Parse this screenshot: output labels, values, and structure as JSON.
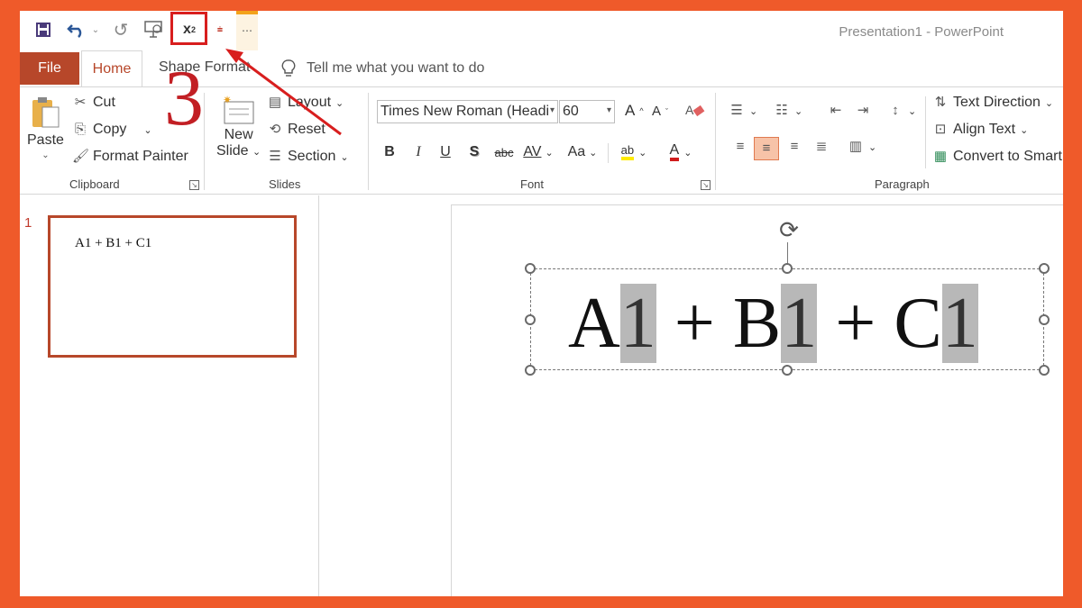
{
  "app": {
    "title": "Presentation1  -  PowerPoint"
  },
  "qat": {
    "save_icon": "save-icon",
    "undo_icon": "undo-icon",
    "redo_icon": "redo-icon",
    "present_icon": "present-from-start-icon",
    "subscript_label": "x",
    "subscript_sub": "2",
    "more_label": "⋯"
  },
  "tabs": {
    "file": "File",
    "home": "Home",
    "shape_format": "Shape Format",
    "tell_me": "Tell me what you want to do"
  },
  "ribbon": {
    "clipboard": {
      "paste": "Paste",
      "cut": "Cut",
      "copy": "Copy",
      "format_painter": "Format Painter",
      "label": "Clipboard"
    },
    "slides": {
      "new_slide_1": "New",
      "new_slide_2": "Slide",
      "layout": "Layout",
      "reset": "Reset",
      "section": "Section",
      "label": "Slides"
    },
    "font": {
      "font_name": "Times New Roman (Headi",
      "font_size": "60",
      "bold": "B",
      "italic": "I",
      "underline": "U",
      "shadow": "S",
      "strike": "abc",
      "spacing": "AV",
      "change_case": "Aa",
      "highlight": "ab",
      "font_color": "A",
      "increase": "A",
      "decrease": "A",
      "label": "Font"
    },
    "paragraph": {
      "text_direction": "Text Direction",
      "align_text": "Align Text",
      "convert_smart": "Convert to Smart",
      "label": "Paragraph"
    }
  },
  "slides_pane": {
    "slide_number": "1",
    "thumb_text": "A1 + B1 + C1"
  },
  "slide": {
    "eq": [
      {
        "text": "A",
        "selected": false
      },
      {
        "text": "1",
        "selected": true
      },
      {
        "text": " + B",
        "selected": false
      },
      {
        "text": "1",
        "selected": true
      },
      {
        "text": " + C",
        "selected": false
      },
      {
        "text": "1",
        "selected": true
      }
    ]
  },
  "annotation": {
    "step_number": "3",
    "color": "#d81e1e"
  },
  "colors": {
    "frame": "#ef5a2a",
    "accent": "#b7472a"
  }
}
